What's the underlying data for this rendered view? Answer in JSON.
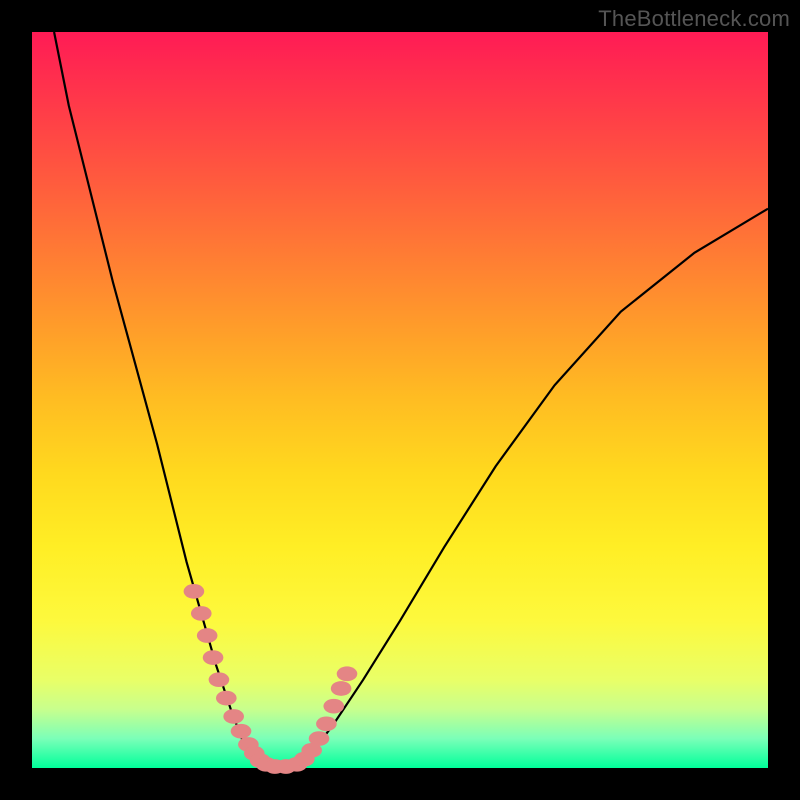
{
  "watermark": "TheBottleneck.com",
  "chart_data": {
    "type": "line",
    "title": "",
    "xlabel": "",
    "ylabel": "",
    "xlim": [
      0,
      100
    ],
    "ylim": [
      0,
      100
    ],
    "series": [
      {
        "name": "curve-left",
        "x": [
          3,
          5,
          8,
          11,
          14,
          17,
          19,
          21,
          23,
          25,
          27,
          28.5,
          30,
          31.5
        ],
        "y": [
          100,
          90,
          78,
          66,
          55,
          44,
          36,
          28,
          21,
          14,
          8,
          4,
          1,
          0
        ]
      },
      {
        "name": "curve-floor",
        "x": [
          31.5,
          33,
          34.5,
          36
        ],
        "y": [
          0,
          0,
          0,
          0
        ]
      },
      {
        "name": "curve-right",
        "x": [
          36,
          38,
          41,
          45,
          50,
          56,
          63,
          71,
          80,
          90,
          100
        ],
        "y": [
          0,
          2,
          6,
          12,
          20,
          30,
          41,
          52,
          62,
          70,
          76
        ]
      }
    ],
    "points": [
      {
        "name": "dots-left",
        "x": [
          22,
          23,
          23.8,
          24.6,
          25.4,
          26.4,
          27.4,
          28.4,
          29.4,
          30.2,
          31,
          31.8,
          33,
          34.5
        ],
        "y": [
          24,
          21,
          18,
          15,
          12,
          9.5,
          7,
          5,
          3.2,
          2,
          1,
          0.5,
          0.2,
          0.2
        ]
      },
      {
        "name": "dots-right",
        "x": [
          36,
          37,
          38,
          39,
          40,
          41,
          42,
          42.8
        ],
        "y": [
          0.5,
          1.2,
          2.4,
          4,
          6,
          8.4,
          10.8,
          12.8
        ]
      }
    ],
    "colors": {
      "curve": "#000000",
      "dots": "#e48585"
    }
  }
}
